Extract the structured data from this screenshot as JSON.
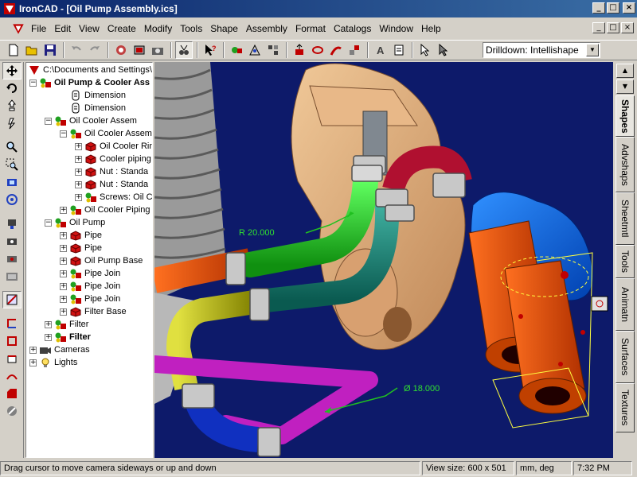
{
  "window": {
    "title": "IronCAD - [Oil Pump Assembly.ics]",
    "minimize": "_",
    "maximize": "□",
    "close": "×"
  },
  "menu": [
    "File",
    "Edit",
    "View",
    "Create",
    "Modify",
    "Tools",
    "Shape",
    "Assembly",
    "Format",
    "Catalogs",
    "Window",
    "Help"
  ],
  "toolbar": {
    "drilldown_value": "Drilldown: Intellishape",
    "arrow": "▼"
  },
  "tree": {
    "root": "C:\\Documents and Settings\\",
    "items": [
      {
        "label": "Oil Pump & Cooler Ass",
        "bold": true
      },
      {
        "label": "Dimension"
      },
      {
        "label": "Dimension"
      },
      {
        "label": "Oil Cooler Assem"
      },
      {
        "label": "Oil Cooler Assem"
      },
      {
        "label": "Oil Cooler Rin"
      },
      {
        "label": "Cooler piping"
      },
      {
        "label": "Nut : Standa"
      },
      {
        "label": "Nut : Standa"
      },
      {
        "label": "Screws: Oil C"
      },
      {
        "label": "Oil Cooler Piping"
      },
      {
        "label": "Oil Pump"
      },
      {
        "label": "Pipe"
      },
      {
        "label": "Pipe"
      },
      {
        "label": "Oil Pump Base"
      },
      {
        "label": "Pipe Join"
      },
      {
        "label": "Pipe Join"
      },
      {
        "label": "Pipe Join"
      },
      {
        "label": "Filter Base"
      },
      {
        "label": "Filter"
      },
      {
        "label": "Filter",
        "bold": true
      },
      {
        "label": "Cameras"
      },
      {
        "label": "Lights"
      }
    ]
  },
  "viewport": {
    "dim_radius": "R 20.000",
    "dim_diameter": "Ø 18.000"
  },
  "right_tabs": [
    "Shapes",
    "Advshaps",
    "Sheetmtl",
    "Tools",
    "Animatn",
    "Surfaces",
    "Textures"
  ],
  "right_arrows": {
    "up": "▲",
    "down": "▼"
  },
  "status": {
    "message": "Drag cursor to move camera sideways or up and down",
    "view_size": "View size:  600 x  501",
    "units": "mm, deg",
    "time": "7:32 PM"
  },
  "colors": {
    "title_start": "#0a246a",
    "title_end": "#3a6ea5",
    "viewport_bg": "#0d1a6a"
  }
}
